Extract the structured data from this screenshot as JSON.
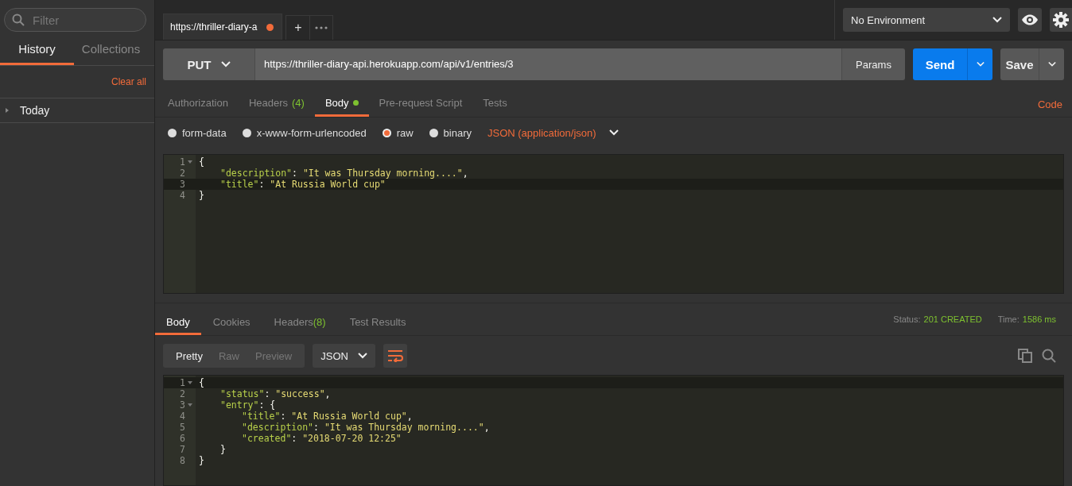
{
  "sidebar": {
    "search": {
      "placeholder": "Filter"
    },
    "tabs": [
      {
        "label": "History",
        "selected": true
      },
      {
        "label": "Collections",
        "selected": false
      }
    ],
    "clear_all": "Clear all",
    "groups": [
      {
        "label": "Today",
        "expanded": false
      }
    ]
  },
  "request_tabs": [
    {
      "label": "https://thriller-diary-a",
      "unsaved": true,
      "selected": true
    }
  ],
  "new_tab": "+",
  "environment": {
    "value": "No Environment"
  },
  "request": {
    "method": "PUT",
    "url": "https://thriller-diary-api.herokuapp.com/api/v1/entries/3",
    "params": "Params",
    "send": "Send",
    "save": "Save"
  },
  "request_sections": [
    {
      "label": "Authorization",
      "selected": false
    },
    {
      "label": "Headers",
      "count": "(4)",
      "selected": false
    },
    {
      "label": "Body",
      "dot": true,
      "selected": true
    },
    {
      "label": "Pre-request Script",
      "selected": false
    },
    {
      "label": "Tests",
      "selected": false
    }
  ],
  "code_link": "Code",
  "body_types": [
    {
      "label": "form-data",
      "selected": false
    },
    {
      "label": "x-www-form-urlencoded",
      "selected": false
    },
    {
      "label": "raw",
      "selected": true
    },
    {
      "label": "binary",
      "selected": false
    }
  ],
  "content_type": "JSON (application/json)",
  "request_body": [
    {
      "number": "1",
      "fold": true,
      "highlighted": false,
      "tokens": [
        {
          "kind": "punct",
          "text": "{"
        }
      ],
      "children": [
        {
          "number": "2",
          "fold": false,
          "highlighted": false,
          "tokens": [
            {
              "kind": "key",
              "text": "\"description\""
            },
            {
              "kind": "punct",
              "text": ": "
            },
            {
              "kind": "string",
              "text": "\"It was Thursday morning....\""
            },
            {
              "kind": "punct",
              "text": ","
            }
          ]
        },
        {
          "number": "3",
          "fold": false,
          "highlighted": true,
          "tokens": [
            {
              "kind": "key",
              "text": "\"title\""
            },
            {
              "kind": "punct",
              "text": ": "
            },
            {
              "kind": "string",
              "text": "\"At Russia World cup\""
            }
          ]
        }
      ]
    },
    {
      "number": "4",
      "fold": false,
      "highlighted": false,
      "tokens": [
        {
          "kind": "punct",
          "text": "}"
        }
      ]
    }
  ],
  "response": {
    "tabs": [
      {
        "label": "Body",
        "selected": true
      },
      {
        "label": "Cookies",
        "selected": false
      },
      {
        "label": "Headers",
        "count": "(8)",
        "selected": false
      },
      {
        "label": "Test Results",
        "selected": false
      }
    ],
    "status_label": "Status:",
    "status": "201 CREATED",
    "time_label": "Time:",
    "time": "1586 ms",
    "view_modes": [
      {
        "label": "Pretty",
        "selected": true
      },
      {
        "label": "Raw",
        "selected": false
      },
      {
        "label": "Preview",
        "selected": false
      }
    ],
    "format": "JSON",
    "lines": [
      {
        "number": "1",
        "fold": true,
        "highlighted": true,
        "tokens": [
          {
            "kind": "punct",
            "text": "{"
          }
        ],
        "children": [
          {
            "number": "2",
            "fold": false,
            "highlighted": false,
            "tokens": [
              {
                "kind": "key",
                "text": "\"status\""
              },
              {
                "kind": "punct",
                "text": ": "
              },
              {
                "kind": "string",
                "text": "\"success\""
              },
              {
                "kind": "punct",
                "text": ","
              }
            ]
          },
          {
            "number": "3",
            "fold": true,
            "highlighted": false,
            "tokens": [
              {
                "kind": "key",
                "text": "\"entry\""
              },
              {
                "kind": "punct",
                "text": ": {"
              }
            ],
            "children": [
              {
                "number": "4",
                "fold": false,
                "highlighted": false,
                "tokens": [
                  {
                    "kind": "key",
                    "text": "\"title\""
                  },
                  {
                    "kind": "punct",
                    "text": ": "
                  },
                  {
                    "kind": "string",
                    "text": "\"At Russia World cup\""
                  },
                  {
                    "kind": "punct",
                    "text": ","
                  }
                ]
              },
              {
                "number": "5",
                "fold": false,
                "highlighted": false,
                "tokens": [
                  {
                    "kind": "key",
                    "text": "\"description\""
                  },
                  {
                    "kind": "punct",
                    "text": ": "
                  },
                  {
                    "kind": "string",
                    "text": "\"It was Thursday morning....\""
                  },
                  {
                    "kind": "punct",
                    "text": ","
                  }
                ]
              },
              {
                "number": "6",
                "fold": false,
                "highlighted": false,
                "tokens": [
                  {
                    "kind": "key",
                    "text": "\"created\""
                  },
                  {
                    "kind": "punct",
                    "text": ": "
                  },
                  {
                    "kind": "string",
                    "text": "\"2018-07-20 12:25\""
                  }
                ]
              }
            ]
          },
          {
            "number": "7",
            "fold": false,
            "highlighted": false,
            "tokens": [
              {
                "kind": "punct",
                "text": "}"
              }
            ]
          }
        ]
      },
      {
        "number": "8",
        "fold": false,
        "highlighted": false,
        "tokens": [
          {
            "kind": "punct",
            "text": "}"
          }
        ]
      }
    ]
  }
}
